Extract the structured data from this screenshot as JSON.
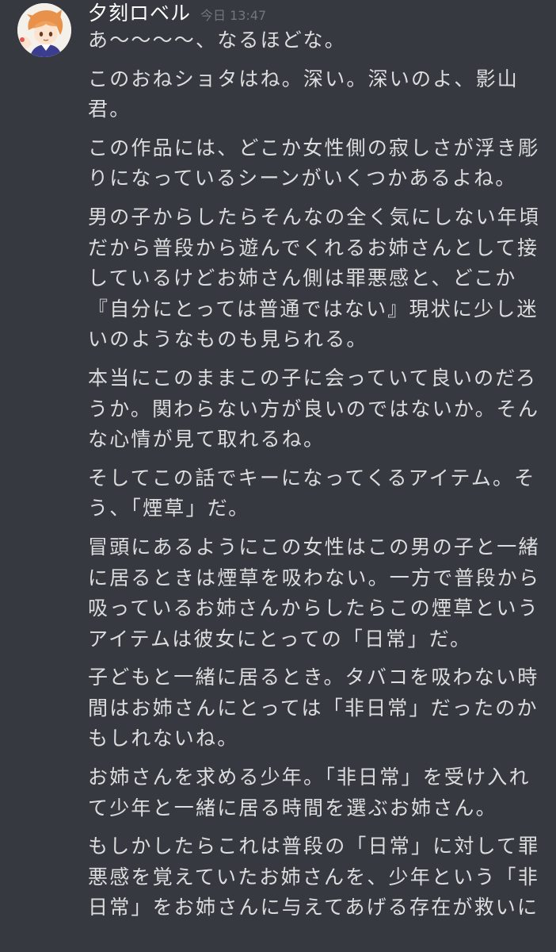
{
  "message": {
    "username": "夕刻ロベル",
    "timestamp": "今日 13:47",
    "avatar_icon": "user-avatar-icon",
    "paragraphs": [
      "あ〜〜〜〜、なるほどな。",
      "このおねショタはね。深い。深いのよ、影山\n君。",
      "この作品には、どこか女性側の寂しさが浮き彫\nりになっているシーンがいくつかあるよね。",
      "男の子からしたらそんなの全く気にしない年頃\nだから普段から遊んでくれるお姉さんとして接\nしているけどお姉さん側は罪悪感と、どこか\n『自分にとっては普通ではない』現状に少し迷\nいのようなものも見られる。",
      "本当にこのままこの子に会っていて良いのだろ\nうか。関わらない方が良いのではないか。そん\nな心情が見て取れるね。",
      "そしてこの話でキーになってくるアイテム。そ\nう、「煙草」だ。",
      "冒頭にあるようにこの女性はこの男の子と一緒\nに居るときは煙草を吸わない。一方で普段から\n吸っているお姉さんからしたらこの煙草という\nアイテムは彼女にとっての「日常」だ。",
      "子どもと一緒に居るとき。タバコを吸わない時\n間はお姉さんにとっては「非日常」だったのか\nもしれないね。",
      "お姉さんを求める少年。「非日常」を受け入れ\nて少年と一緒に居る時間を選ぶお姉さん。",
      "もしかしたらこれは普段の「日常」に対して罪\n悪感を覚えていたお姉さんを、少年という「非\n日常」をお姉さんに与えてあげる存在が救いに"
    ]
  },
  "colors": {
    "background": "#36393f",
    "text": "#dcddde",
    "username": "#ffffff",
    "timestamp": "#72767d"
  }
}
